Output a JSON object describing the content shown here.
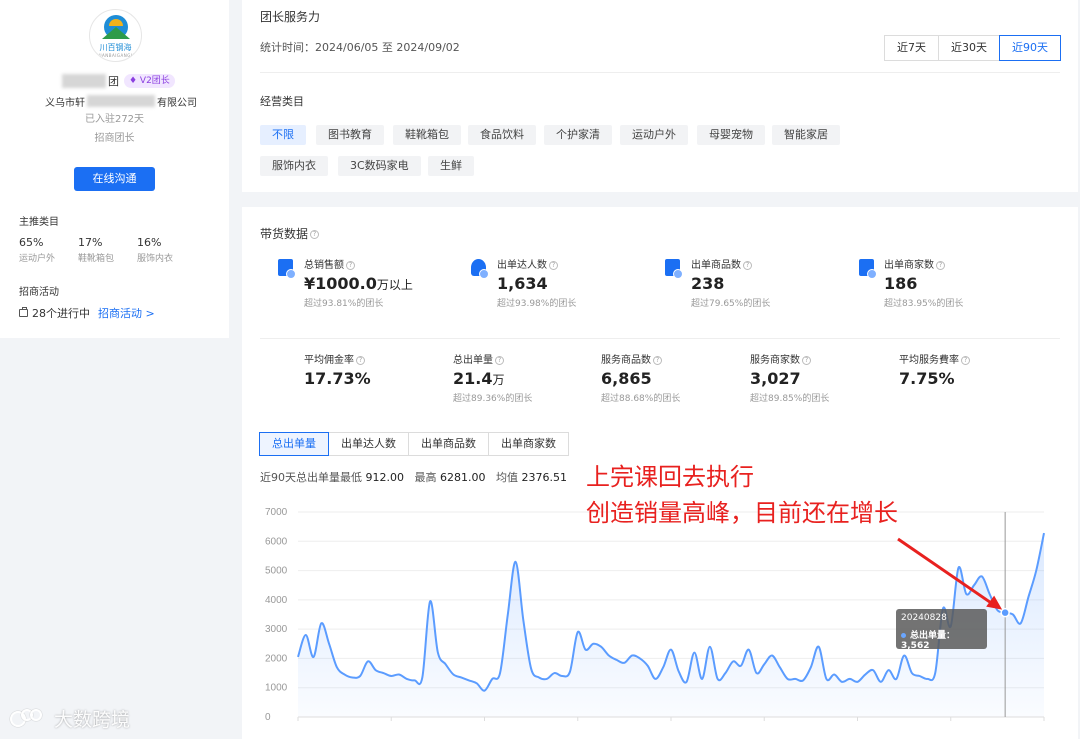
{
  "profile": {
    "name_suffix": "团",
    "badge": "♦ V2团长",
    "company_prefix": "义乌市轩",
    "company_suffix": "有限公司",
    "settled": "已入驻272天",
    "role": "招商团长",
    "online_button": "在线沟通",
    "logo_text": "川百钢海",
    "logo_sub": "CHUANBAIGANGHAI"
  },
  "main_categories": {
    "title": "主推类目",
    "items": [
      {
        "pct": "65%",
        "name": "运动户外"
      },
      {
        "pct": "17%",
        "name": "鞋靴箱包"
      },
      {
        "pct": "16%",
        "name": "服饰内衣"
      }
    ]
  },
  "activities": {
    "title": "招商活动",
    "running": "28个进行中",
    "link": "招商活动 >"
  },
  "service": {
    "title": "团长服务力",
    "time": "统计时间：2024/06/05 至 2024/09/02",
    "ranges": [
      "近7天",
      "近30天",
      "近90天"
    ],
    "active_range": "近90天",
    "biz_label": "经营类目",
    "chips": [
      "不限",
      "图书教育",
      "鞋靴箱包",
      "食品饮料",
      "个护家清",
      "运动户外",
      "母婴宠物",
      "智能家居",
      "服饰内衣",
      "3C数码家电",
      "生鲜"
    ]
  },
  "sales": {
    "title": "带货数据",
    "metrics_row1": [
      {
        "label": "总销售额",
        "value": "¥1000.0",
        "unit": "万以上",
        "sub": "超过93.81%的团长",
        "icon": "sales-icon",
        "color": "#1b6ff3"
      },
      {
        "label": "出单达人数",
        "value": "1,634",
        "unit": "",
        "sub": "超过93.98%的团长",
        "icon": "person-icon",
        "color": "#1b6ff3"
      },
      {
        "label": "出单商品数",
        "value": "238",
        "unit": "",
        "sub": "超过79.65%的团长",
        "icon": "cart-icon",
        "color": "#1b6ff3"
      },
      {
        "label": "出单商家数",
        "value": "186",
        "unit": "",
        "sub": "超过83.95%的团长",
        "icon": "store-icon",
        "color": "#1b6ff3"
      }
    ],
    "metrics_row2": [
      {
        "label": "平均佣金率",
        "value": "17.73%",
        "unit": "",
        "sub": ""
      },
      {
        "label": "总出单量",
        "value": "21.4",
        "unit": "万",
        "sub": "超过89.36%的团长"
      },
      {
        "label": "服务商品数",
        "value": "6,865",
        "unit": "",
        "sub": "超过88.68%的团长"
      },
      {
        "label": "服务商家数",
        "value": "3,027",
        "unit": "",
        "sub": "超过89.85%的团长"
      },
      {
        "label": "平均服务費率",
        "value": "7.75%",
        "unit": "",
        "sub": ""
      }
    ],
    "tabs": [
      "总出单量",
      "出单达人数",
      "出单商品数",
      "出单商家数"
    ],
    "active_tab": "总出单量",
    "summary_prefix": "近90天总出单量最低",
    "min": "912.00",
    "max_label": "最高",
    "max": "6281.00",
    "avg_label": "均值",
    "avg": "2376.51"
  },
  "annotation": {
    "line1": "上完课回去执行",
    "line2": "创造销量高峰，目前还在增长",
    "color": "#e8211f"
  },
  "tooltip": {
    "date": "20240828",
    "series": "总出单量",
    "value": "3,562"
  },
  "watermark": "大数跨境",
  "chart_data": {
    "type": "area",
    "title": "",
    "xlabel": "",
    "ylabel": "",
    "ylim": [
      0,
      7000
    ],
    "yticks": [
      0,
      1000,
      2000,
      3000,
      4000,
      5000,
      6000,
      7000
    ],
    "grid": true,
    "legend": "none",
    "color": "#5b9cff",
    "series": [
      {
        "name": "总出单量",
        "values": [
          2050,
          2800,
          2050,
          3200,
          2500,
          1700,
          1450,
          1350,
          1400,
          1900,
          1600,
          1500,
          1400,
          1450,
          1300,
          1250,
          1350,
          3950,
          2200,
          1800,
          1450,
          1350,
          1250,
          1150,
          900,
          1300,
          1500,
          3500,
          5300,
          3300,
          1650,
          1350,
          1300,
          1500,
          1400,
          1550,
          2900,
          2300,
          2500,
          2400,
          2100,
          1950,
          1850,
          2100,
          2000,
          1750,
          1300,
          1700,
          2300,
          1550,
          1200,
          2200,
          1300,
          2400,
          1300,
          1500,
          1900,
          1750,
          2300,
          1500,
          1800,
          2100,
          1700,
          1300,
          1300,
          1250,
          1700,
          2400,
          1300,
          1450,
          1200,
          1300,
          1200,
          1450,
          1600,
          1200,
          1600,
          1300,
          2100,
          1500,
          1400,
          1300,
          1500,
          3700,
          3100,
          5100,
          4200,
          4500,
          4800,
          4200,
          3650,
          3562,
          3500,
          3200,
          4100,
          5000,
          6281
        ]
      }
    ],
    "highlight": {
      "date": "20240828",
      "value": 3562
    }
  }
}
